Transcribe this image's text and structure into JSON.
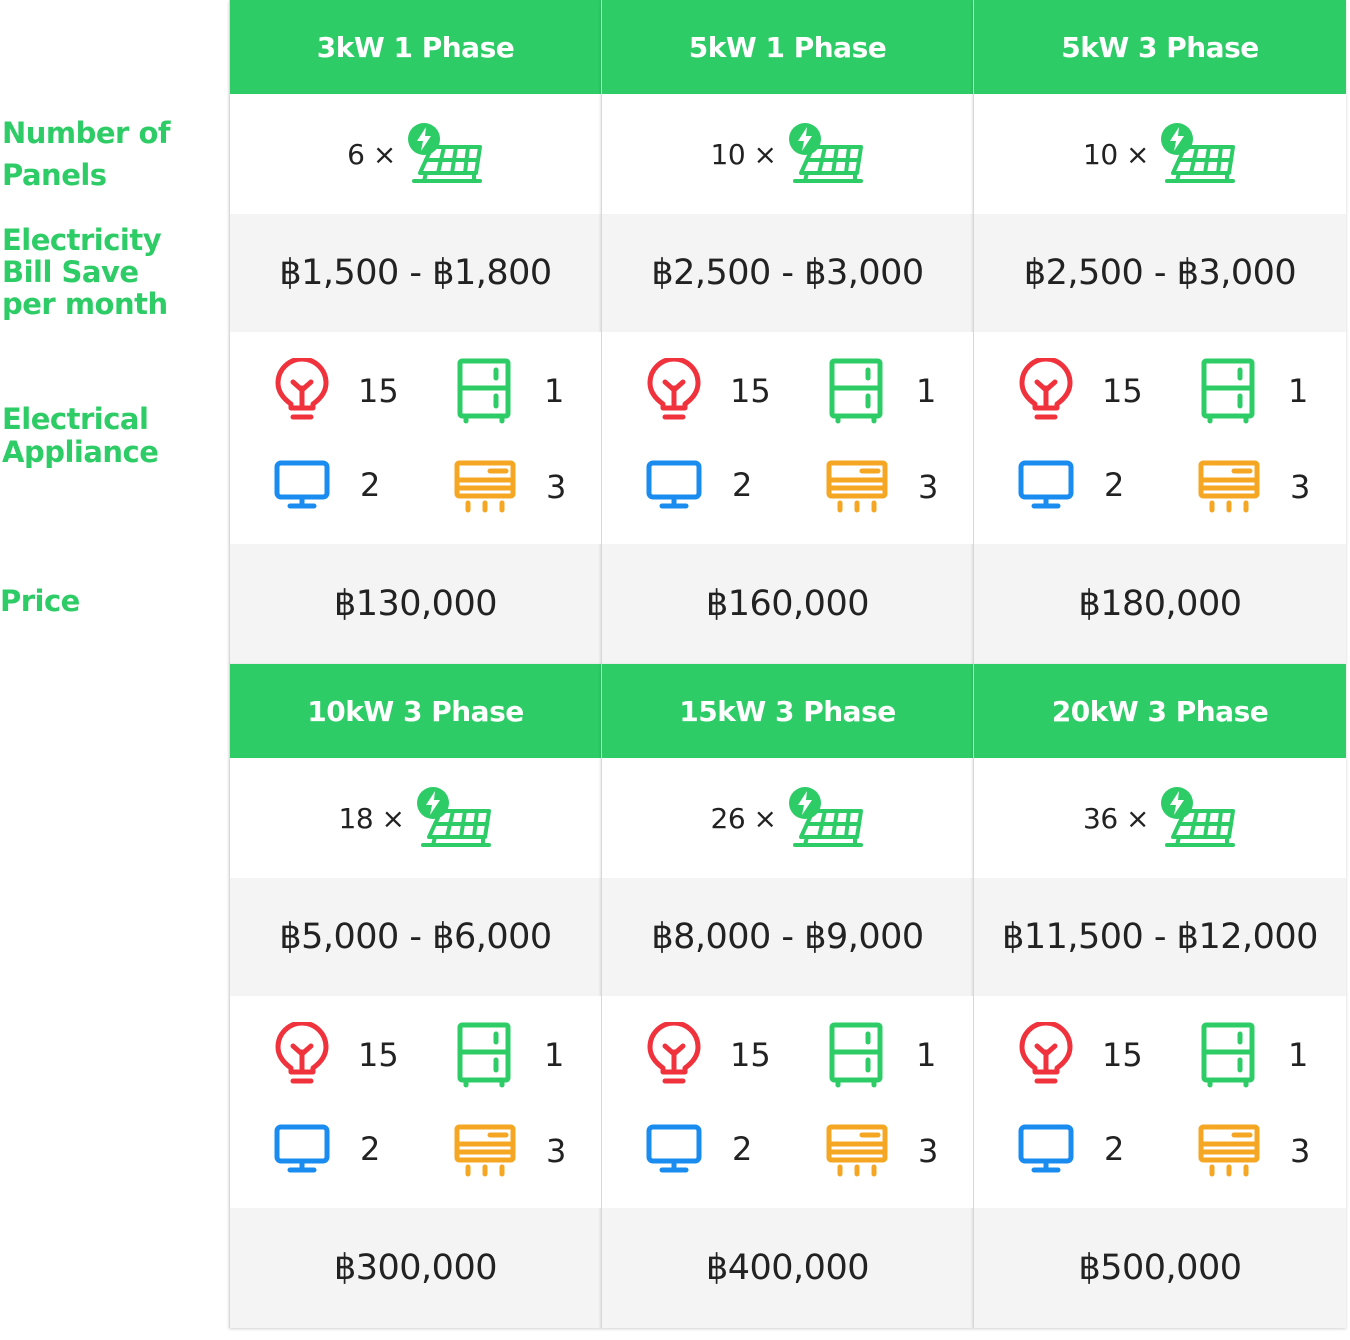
{
  "row_labels": {
    "panels": [
      "Number of",
      "Panels"
    ],
    "bill": [
      "Electricity",
      "Bill Save",
      "per month"
    ],
    "appliance": [
      "Electrical",
      "Appliance"
    ],
    "price": "Price"
  },
  "colors": {
    "brand_green": "#2dcc66",
    "bulb_red": "#f0323c",
    "tv_blue": "#1a8cf0",
    "ac_orange": "#f5a623",
    "fridge_green": "#2dcc66"
  },
  "icons": {
    "panel": "solar-panel-icon",
    "bulb": "light-bulb-icon",
    "fridge": "refrigerator-icon",
    "tv": "tv-icon",
    "ac": "air-conditioner-icon"
  },
  "plans": [
    {
      "name": "3kW 1 Phase",
      "panels": "6 ×",
      "bill": "฿1,500 - ฿1,800",
      "appliances": {
        "bulb": "15",
        "fridge": "1",
        "tv": "2",
        "ac": "3"
      },
      "price": "฿130,000"
    },
    {
      "name": "5kW 1 Phase",
      "panels": "10 ×",
      "bill": "฿2,500 - ฿3,000",
      "appliances": {
        "bulb": "15",
        "fridge": "1",
        "tv": "2",
        "ac": "3"
      },
      "price": "฿160,000"
    },
    {
      "name": "5kW 3 Phase",
      "panels": "10 ×",
      "bill": "฿2,500 - ฿3,000",
      "appliances": {
        "bulb": "15",
        "fridge": "1",
        "tv": "2",
        "ac": "3"
      },
      "price": "฿180,000"
    },
    {
      "name": "10kW 3 Phase",
      "panels": "18 ×",
      "bill": "฿5,000 - ฿6,000",
      "appliances": {
        "bulb": "15",
        "fridge": "1",
        "tv": "2",
        "ac": "3"
      },
      "price": "฿300,000"
    },
    {
      "name": "15kW 3 Phase",
      "panels": "26 ×",
      "bill": "฿8,000 - ฿9,000",
      "appliances": {
        "bulb": "15",
        "fridge": "1",
        "tv": "2",
        "ac": "3"
      },
      "price": "฿400,000"
    },
    {
      "name": "20kW 3 Phase",
      "panels": "36 ×",
      "bill": "฿11,500 - ฿12,000",
      "appliances": {
        "bulb": "15",
        "fridge": "1",
        "tv": "2",
        "ac": "3"
      },
      "price": "฿500,000"
    }
  ]
}
